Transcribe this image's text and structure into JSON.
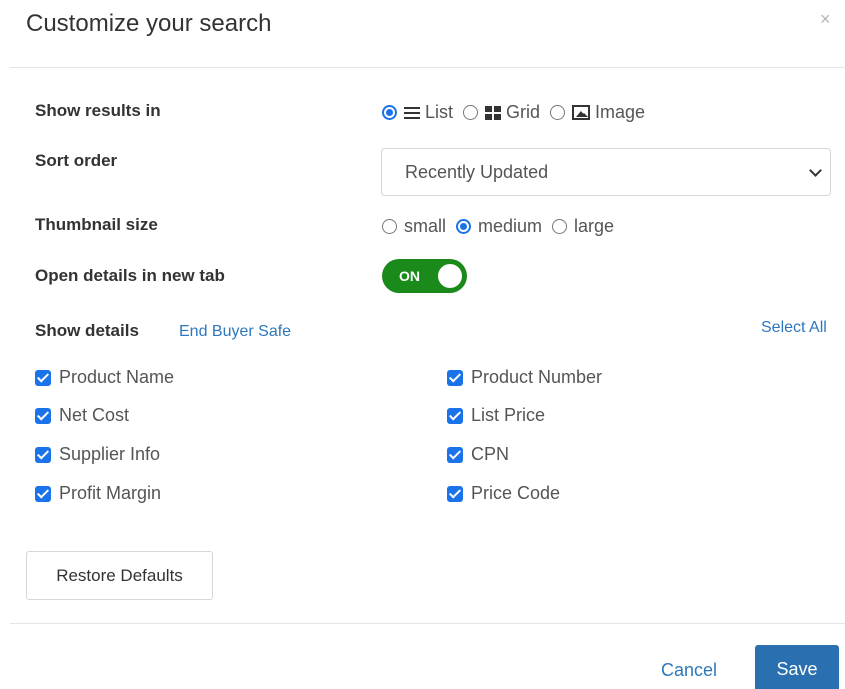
{
  "modal": {
    "title": "Customize your search",
    "close_glyph": "×"
  },
  "show_results": {
    "label": "Show results in",
    "options": [
      {
        "label": "List",
        "icon": "list-icon",
        "checked": true
      },
      {
        "label": "Grid",
        "icon": "grid-icon",
        "checked": false
      },
      {
        "label": "Image",
        "icon": "image-icon",
        "checked": false
      }
    ]
  },
  "sort_order": {
    "label": "Sort order",
    "selected": "Recently Updated"
  },
  "thumbnail_size": {
    "label": "Thumbnail size",
    "options": [
      {
        "label": "small",
        "checked": false
      },
      {
        "label": "medium",
        "checked": true
      },
      {
        "label": "large",
        "checked": false
      }
    ]
  },
  "open_details": {
    "label": "Open details in new tab",
    "toggle_text": "ON",
    "on": true,
    "color": "#1a8a1a"
  },
  "show_details": {
    "label": "Show details",
    "end_buyer_safe": "End Buyer Safe",
    "select_all": "Select All",
    "left": [
      {
        "label": "Product Name",
        "checked": true
      },
      {
        "label": "Net Cost",
        "checked": true
      },
      {
        "label": "Supplier Info",
        "checked": true
      },
      {
        "label": "Profit Margin",
        "checked": true
      }
    ],
    "right": [
      {
        "label": "Product Number",
        "checked": true
      },
      {
        "label": "List Price",
        "checked": true
      },
      {
        "label": "CPN",
        "checked": true
      },
      {
        "label": "Price Code",
        "checked": true
      }
    ]
  },
  "footer": {
    "restore_defaults": "Restore Defaults",
    "cancel": "Cancel",
    "save": "Save"
  },
  "colors": {
    "accent": "#1a73e8",
    "link": "#2e77bb",
    "primary_button": "#2a6fb0"
  }
}
